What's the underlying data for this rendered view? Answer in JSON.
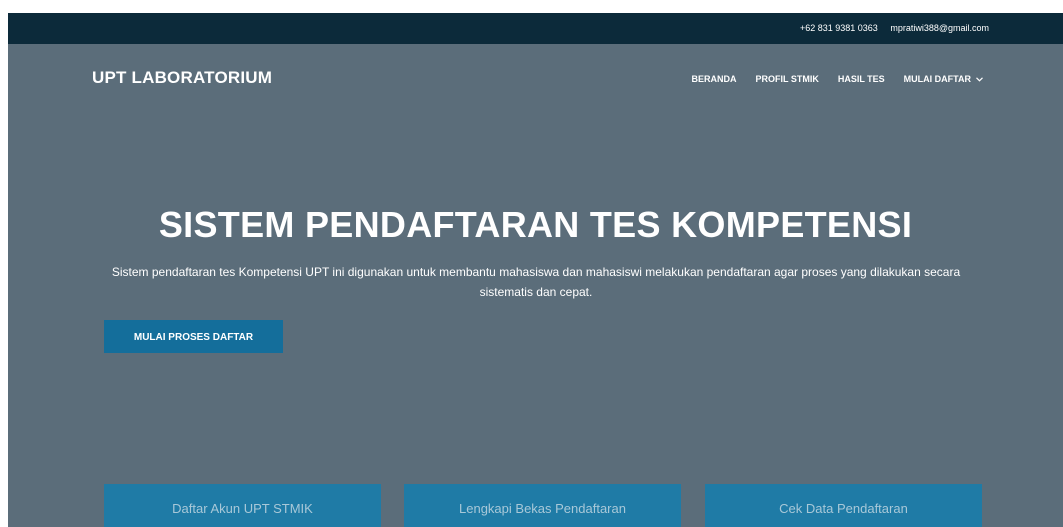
{
  "topbar": {
    "phone": "+62 831 9381 0363",
    "email": "mpratiwi388@gmail.com"
  },
  "header": {
    "brand": "UPT LABORATORIUM",
    "nav": [
      {
        "label": "BERANDA"
      },
      {
        "label": "PROFIL STMIK"
      },
      {
        "label": "HASIL TES"
      },
      {
        "label": "MULAI DAFTAR",
        "icon": "chevron-down-icon"
      }
    ]
  },
  "hero": {
    "title": "SISTEM PENDAFTARAN TES KOMPETENSI",
    "description": "Sistem pendaftaran tes Kompetensi UPT ini digunakan untuk membantu mahasiswa dan mahasiswi melakukan pendaftaran agar proses yang dilakukan secara sistematis dan cepat.",
    "cta_label": "MULAI PROSES DAFTAR"
  },
  "cards": [
    {
      "label": "Daftar Akun UPT STMIK"
    },
    {
      "label": "Lengkapi Bekas Pendaftaran"
    },
    {
      "label": "Cek Data Pendaftaran"
    }
  ],
  "colors": {
    "topbar_bg": "#0c2a3a",
    "hero_bg": "#5b6d7a",
    "accent": "#146e9b",
    "card_bg": "#1f7ba6"
  }
}
